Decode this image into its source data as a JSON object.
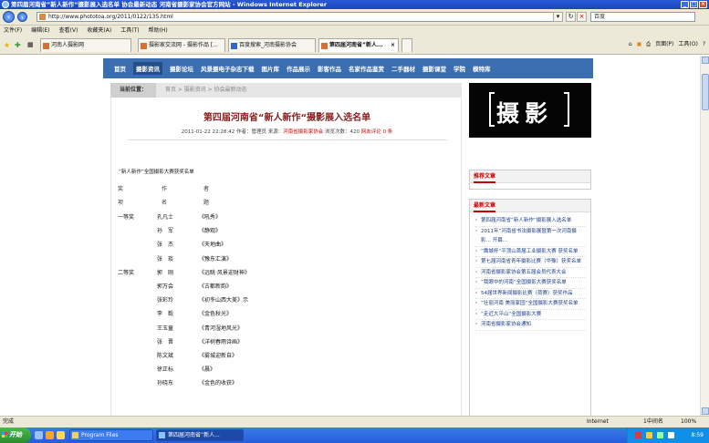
{
  "window": {
    "title": "第四届河南省”新人新作“摄影展入选名单 协会最新动态 河南省摄影家协会官方网站 - Windows Internet Explorer"
  },
  "address": {
    "url": "http://www.phototoa.org/2011/0122/135.html",
    "search_placeholder": "百度"
  },
  "menu": [
    "文件(F)",
    "编辑(E)",
    "查看(V)",
    "收藏夹(A)",
    "工具(T)",
    "帮助(H)"
  ],
  "tabs": [
    {
      "label": "河南人摄影网"
    },
    {
      "label": "摄影家交流网 - 摄影作品 [..."
    },
    {
      "label": "百度搜索_河南摄影协会"
    },
    {
      "label": "第四届河南省”新人..."
    }
  ],
  "ie_tools": {
    "page": "页面(P)",
    "tools": "工具(O)"
  },
  "site_nav": [
    "首页",
    "摄影资讯",
    "摄影论坛",
    "风景摄电子杂志下载",
    "图片库",
    "作品展示",
    "影客作品",
    "名家作品鉴赏",
    "二手器材",
    "摄影课堂",
    "学院",
    "模特库"
  ],
  "breadcrumb": {
    "label": "当前位置：",
    "path": "首页 > 摄影资讯 > 协会最新动态"
  },
  "article": {
    "title": "第四届河南省“新人新作“摄影展入选名单",
    "meta_prefix": "2011-01-22 22:28:42 作者：管理员 来源：",
    "source": "河南省摄影家协会",
    "views": " 浏览次数：420 ",
    "comments": "网友评论 0 条",
    "intro": "“新人新作”全国摄影大赛获奖名单",
    "col_award": "奖",
    "col_name": "作",
    "col_work": "者",
    "col_award2": "项",
    "col_name2": "名",
    "col_work2": "题",
    "rows": [
      {
        "award": "一等奖",
        "name": "孔凡士",
        "work": "《吼秀》"
      },
      {
        "award": "",
        "name": "孙　军",
        "work": "《静观》"
      },
      {
        "award": "",
        "name": "张　杰",
        "work": "《天地曲》"
      },
      {
        "award": "",
        "name": "张　琰",
        "work": "《豫东汇演》"
      },
      {
        "award": "二等奖",
        "name": "郭　刚",
        "work": "《远眺·风景迎财神》"
      },
      {
        "award": "",
        "name": "郭万会",
        "work": "《古都新韵》"
      },
      {
        "award": "",
        "name": "张彩玲",
        "work": "《初冬山西大美》示"
      },
      {
        "award": "",
        "name": "李　毅",
        "work": "《金色秋光》"
      },
      {
        "award": "",
        "name": "王玉童",
        "work": "《青河湿地风光》"
      },
      {
        "award": "",
        "name": "张　晋",
        "work": "《洋树春雨诗画》"
      },
      {
        "award": "",
        "name": "陈文斌",
        "work": "《雾城迎新自》"
      },
      {
        "award": "",
        "name": "徐正标",
        "work": "《晨》"
      },
      {
        "award": "",
        "name": "孙晓东",
        "work": "《金色的收获》"
      }
    ]
  },
  "sidebar": {
    "logo_text": "摄影",
    "box1_title": "推荐文章",
    "box2_title": "最新文章",
    "items": [
      "第四届河南省”新人新作“摄影展入选名单",
      "2011年”河南省书法摄影展暨第一次河南摄影… 开幕…",
      "”鹰城杯“平顶山首届工业摄影大赛 获奖名单",
      "第七届河南省青年摄影比赛（华豫）获奖名单",
      "河南省摄影家协会第五届会员代表大会",
      "”我眼中的河南“全国摄影大赛获奖名单",
      "54届世界新闻摄影比赛（荷赛）获奖作品",
      "”壮丽河南 美丽家园“全国摄影大赛获奖名单",
      "”走近大平山“全国摄影大赛",
      "河南省摄影家协会通知"
    ]
  },
  "status": {
    "left": "完成",
    "zone": "Internet",
    "zoom": "1中间名",
    "zoom2": "100%"
  },
  "taskbar": {
    "start": "开始",
    "tasks": [
      {
        "label": "Program Files"
      },
      {
        "label": "第四届河南省”新人..."
      }
    ],
    "clock": "8:59"
  }
}
